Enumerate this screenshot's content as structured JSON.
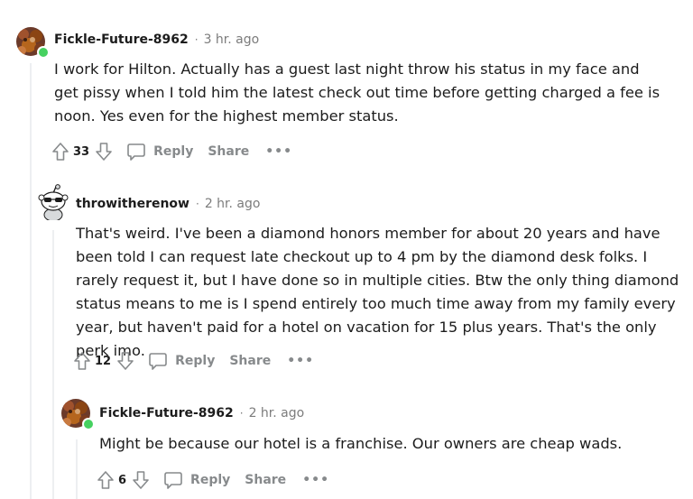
{
  "comments": [
    {
      "username": "Fickle-Future-8962",
      "timestamp": "3 hr. ago",
      "body": "I work for Hilton. Actually has a guest last night throw his status in my face and get pissy when I told him the latest check out time before getting charged a fee is noon. Yes even for the highest member status.",
      "score": "33",
      "reply_label": "Reply",
      "share_label": "Share",
      "more_label": "•••",
      "online": true
    },
    {
      "username": "throwitherenow",
      "timestamp": "2 hr. ago",
      "body": "That's weird. I've been a diamond honors member for about 20 years and have been told I can request late checkout up to 4 pm by the diamond desk folks. I rarely request it, but I have done so in multiple cities. Btw the only thing diamond status means to me is I spend entirely too much time away from my family every year, but haven't paid for a hotel on vacation for 15 plus years. That's the only perk imo.",
      "score": "12",
      "reply_label": "Reply",
      "share_label": "Share",
      "more_label": "•••",
      "online": false
    },
    {
      "username": "Fickle-Future-8962",
      "timestamp": "2 hr. ago",
      "body": "Might be because our hotel is a franchise. Our owners are cheap wads.",
      "score": "6",
      "reply_label": "Reply",
      "share_label": "Share",
      "more_label": "•••",
      "online": true
    }
  ],
  "separator": "·",
  "colors": {
    "text": "#1c1c1c",
    "meta": "#7c7c7c",
    "action": "#878a8c",
    "thread_line": "#edeff1",
    "online": "#46d160"
  }
}
